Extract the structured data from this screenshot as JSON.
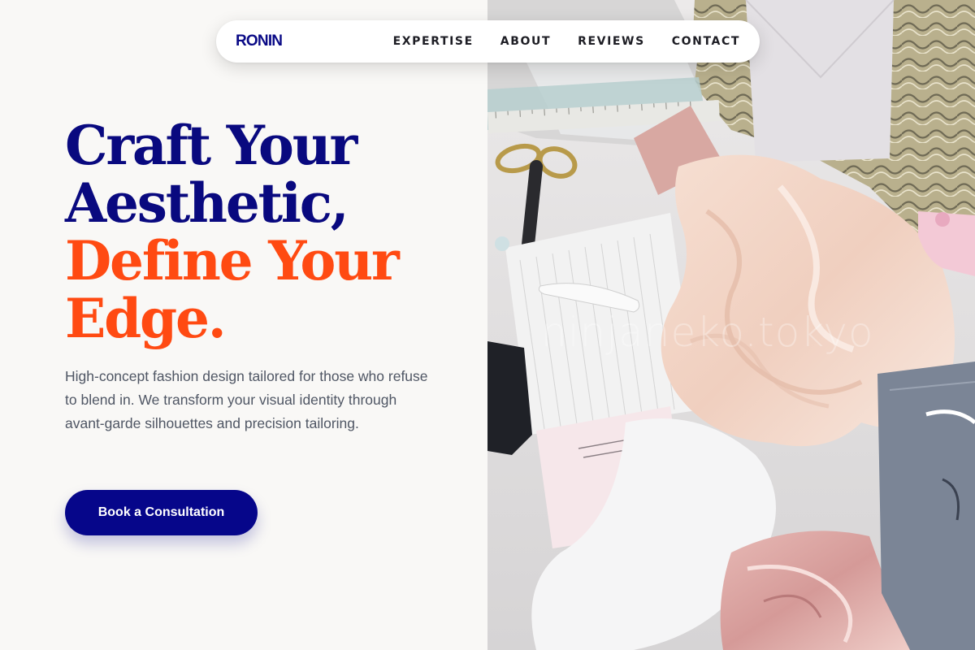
{
  "nav": {
    "logo": "RONIN",
    "links": [
      "EXPERTISE",
      "ABOUT",
      "REVIEWS",
      "CONTACT"
    ]
  },
  "hero": {
    "headline_line1": "Craft Your",
    "headline_line2": "Aesthetic,",
    "headline_line3": "Define Your",
    "headline_line4": "Edge.",
    "description": "High-concept fashion design tailored for those who refuse to blend in. We transform your visual identity through avant-garde silhouettes and precision tailoring.",
    "cta_label": "Book a Consultation",
    "image_watermark": "ninjaneko.tokyo"
  },
  "colors": {
    "brand_navy": "#09097f",
    "accent_orange": "#ff4a12",
    "background": "#f9f8f6",
    "body_text": "#4f5664"
  }
}
